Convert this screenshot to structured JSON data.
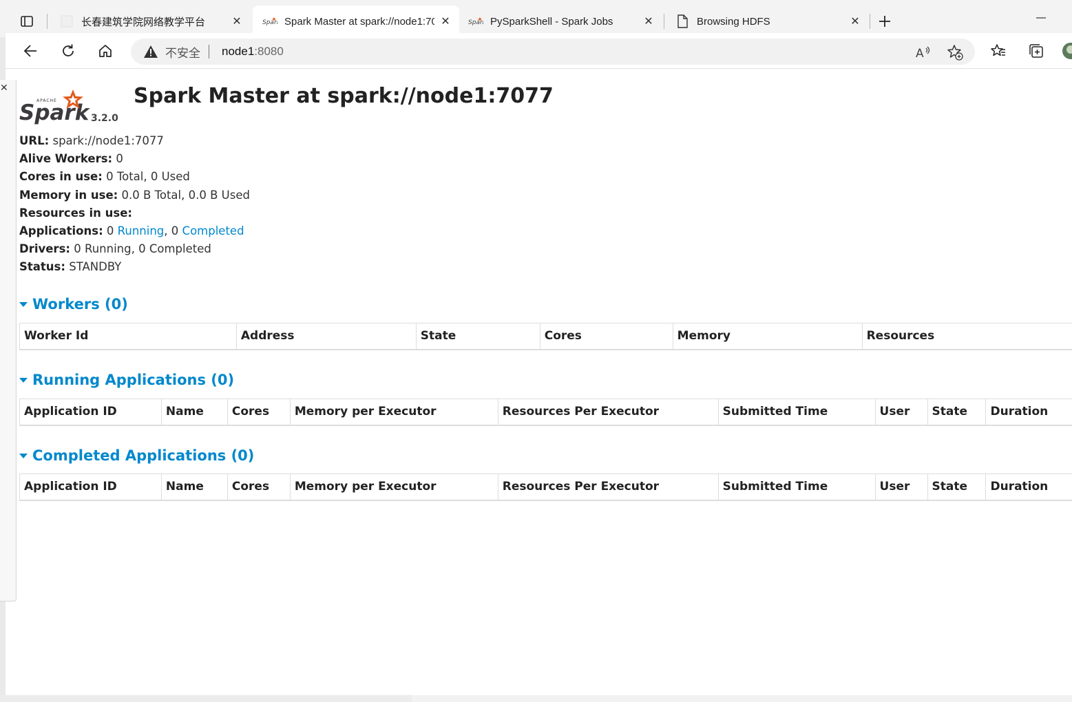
{
  "browser": {
    "tabs": [
      {
        "title": "长春建筑学院网络教学平台",
        "active": false,
        "favicon": "blank-page-icon"
      },
      {
        "title": "Spark Master at spark://node1:7077",
        "active": true,
        "favicon": "spark-icon"
      },
      {
        "title": "PySparkShell - Spark Jobs",
        "active": false,
        "favicon": "spark-icon"
      },
      {
        "title": "Browsing HDFS",
        "active": false,
        "favicon": "document-icon"
      }
    ],
    "address_bar": {
      "security_label": "不安全",
      "host": "node1",
      "port": ":8080"
    }
  },
  "page": {
    "logo_version": "3.2.0",
    "title": "Spark Master at spark://node1:7077",
    "summary": {
      "url_label": "URL:",
      "url_value": "spark://node1:7077",
      "alive_workers_label": "Alive Workers:",
      "alive_workers_value": "0",
      "cores_label": "Cores in use:",
      "cores_value": "0 Total, 0 Used",
      "memory_label": "Memory in use:",
      "memory_value": "0.0 B Total, 0.0 B Used",
      "resources_label": "Resources in use:",
      "applications_label": "Applications:",
      "applications_running_count": "0",
      "applications_running_link": "Running",
      "applications_completed_count": "0",
      "applications_completed_link": "Completed",
      "drivers_label": "Drivers:",
      "drivers_value": "0 Running, 0 Completed",
      "status_label": "Status:",
      "status_value": "STANDBY"
    },
    "workers": {
      "title": "Workers (0)",
      "columns": [
        "Worker Id",
        "Address",
        "State",
        "Cores",
        "Memory",
        "Resources"
      ]
    },
    "running_apps": {
      "title": "Running Applications (0)",
      "columns": [
        "Application ID",
        "Name",
        "Cores",
        "Memory per Executor",
        "Resources Per Executor",
        "Submitted Time",
        "User",
        "State",
        "Duration"
      ]
    },
    "completed_apps": {
      "title": "Completed Applications (0)",
      "columns": [
        "Application ID",
        "Name",
        "Cores",
        "Memory per Executor",
        "Resources Per Executor",
        "Submitted Time",
        "User",
        "State",
        "Duration"
      ]
    }
  },
  "colors": {
    "link": "#0088cc",
    "spark_orange": "#e25a1c"
  }
}
